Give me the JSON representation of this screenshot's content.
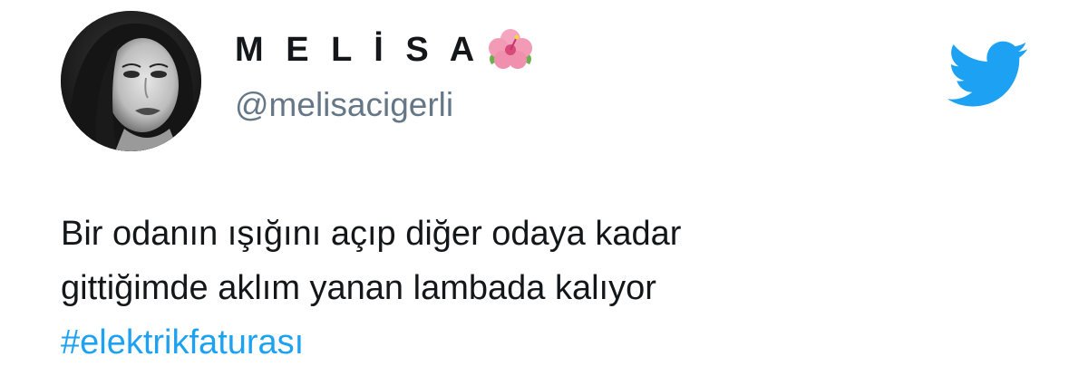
{
  "user": {
    "display_name": "M E L İ S A",
    "emoji_icon": "hibiscus-icon",
    "handle": "@melisacigerli"
  },
  "brand": {
    "logo": "twitter-bird-icon",
    "color": "#1da1f2"
  },
  "tweet": {
    "lines": [
      "Bir odanın ışığını açıp diğer odaya kadar",
      "gittiğimde aklım yanan lambada kalıyor"
    ],
    "hashtag": "#elektrikfaturası"
  },
  "colors": {
    "text": "#14171a",
    "handle": "#657786",
    "link": "#1da1f2"
  }
}
